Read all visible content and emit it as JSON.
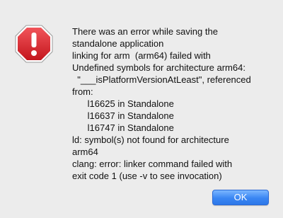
{
  "dialog": {
    "icon": "stop-octagon-exclamation-icon",
    "message": "There was an error while saving the\nstandalone application\nlinking for arm  (arm64) failed with\nUndefined symbols for architecture arm64:\n  \"___isPlatformVersionAtLeast\", referenced\nfrom:\n      l16625 in Standalone\n      l16637 in Standalone\n      l16747 in Standalone\nld: symbol(s) not found for architecture\narm64\nclang: error: linker command failed with\nexit code 1 (use -v to see invocation)",
    "ok_label": "OK"
  },
  "colors": {
    "background": "#ececec",
    "icon_red": "#d7282f",
    "button_blue": "#3a86f3"
  }
}
